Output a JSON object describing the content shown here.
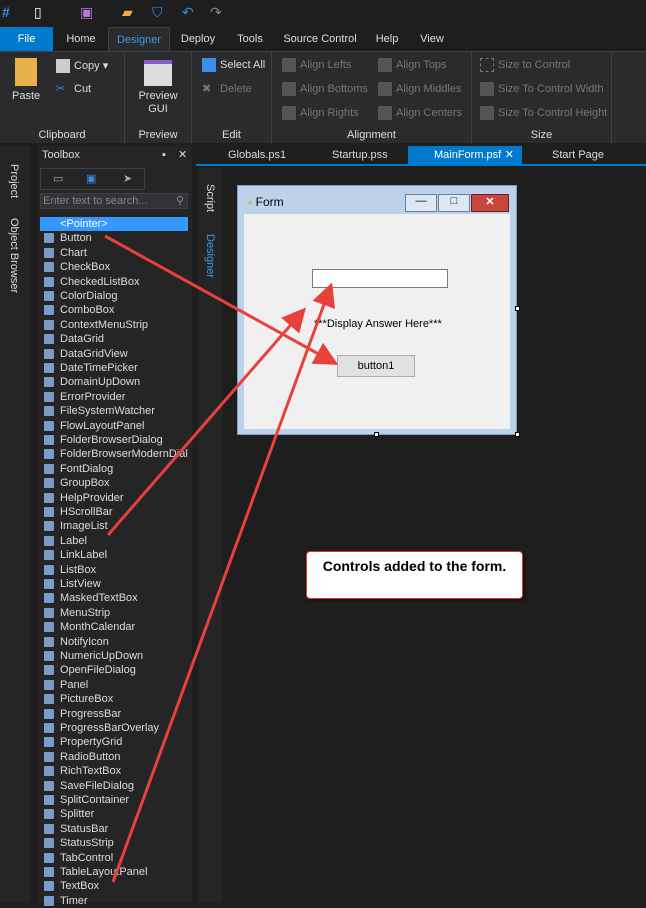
{
  "ribbon_tabs": [
    "File",
    "Home",
    "Designer",
    "Deploy",
    "Tools",
    "Source Control",
    "Help",
    "View"
  ],
  "active_tab": "Designer",
  "clipboard": {
    "paste": "Paste",
    "copy": "Copy",
    "cut": "Cut",
    "label": "Clipboard"
  },
  "preview": {
    "button": "Preview GUI",
    "label": "Preview"
  },
  "edit": {
    "select_all": "Select All",
    "delete": "Delete",
    "label": "Edit"
  },
  "alignment": {
    "lefts": "Align Lefts",
    "bottoms": "Align Bottoms",
    "rights": "Align Rights",
    "tops": "Align Tops",
    "middles": "Align Middles",
    "centers": "Align Centers",
    "label": "Alignment"
  },
  "size": {
    "to_control": "Size to Control",
    "width": "Size To Control Width",
    "height": "Size To Control Height",
    "label": "Size"
  },
  "left_panels": [
    "Project",
    "Object Browser"
  ],
  "toolbox": {
    "title": "Toolbox",
    "search_placeholder": "Enter text to search...",
    "items": [
      "<Pointer>",
      "Button",
      "Chart",
      "CheckBox",
      "CheckedListBox",
      "ColorDialog",
      "ComboBox",
      "ContextMenuStrip",
      "DataGrid",
      "DataGridView",
      "DateTimePicker",
      "DomainUpDown",
      "ErrorProvider",
      "FileSystemWatcher",
      "FlowLayoutPanel",
      "FolderBrowserDialog",
      "FolderBrowserModernDialog",
      "FontDialog",
      "GroupBox",
      "HelpProvider",
      "HScrollBar",
      "ImageList",
      "Label",
      "LinkLabel",
      "ListBox",
      "ListView",
      "MaskedTextBox",
      "MenuStrip",
      "MonthCalendar",
      "NotifyIcon",
      "NumericUpDown",
      "OpenFileDialog",
      "Panel",
      "PictureBox",
      "ProgressBar",
      "ProgressBarOverlay",
      "PropertyGrid",
      "RadioButton",
      "RichTextBox",
      "SaveFileDialog",
      "SplitContainer",
      "Splitter",
      "StatusBar",
      "StatusStrip",
      "TabControl",
      "TableLayoutPanel",
      "TextBox",
      "Timer"
    ]
  },
  "doc_tabs": [
    "Globals.ps1",
    "Startup.pss",
    "MainForm.psf",
    "Start Page"
  ],
  "active_doc": "MainForm.psf",
  "side_tabs": [
    "Script",
    "Designer"
  ],
  "form": {
    "title": "Form",
    "label": "***Display Answer Here***",
    "button": "button1",
    "textbox_value": ""
  },
  "annotation": "Controls added to the form.",
  "colors": {
    "accent": "#007acc",
    "selection": "#3399ff",
    "arrow": "#e8413c"
  }
}
